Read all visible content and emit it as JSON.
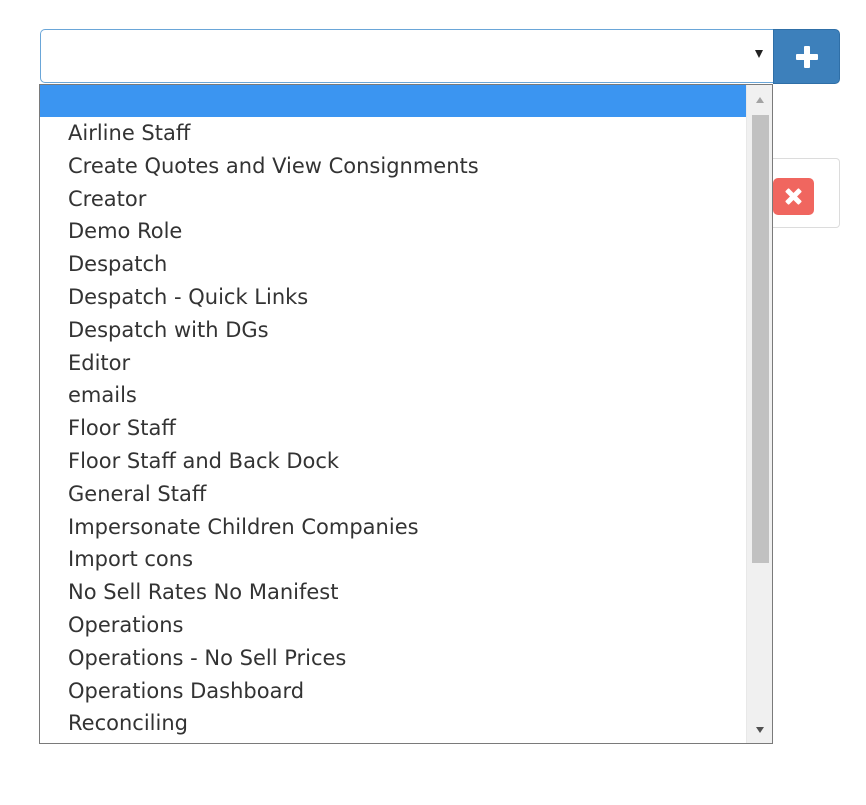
{
  "select": {
    "value": "",
    "caret_icon": "caret-down-icon"
  },
  "add_button": {
    "icon": "plus-icon",
    "color": "#3d80bb"
  },
  "remove_button": {
    "icon": "times-icon",
    "color": "#f0665f"
  },
  "dropdown": {
    "highlighted_option": "",
    "highlight_color": "#3b95f1",
    "options": [
      "Airline Staff",
      "Create Quotes and View Consignments",
      "Creator",
      "Demo Role",
      "Despatch",
      "Despatch - Quick Links",
      "Despatch with DGs",
      "Editor",
      "emails",
      "Floor Staff",
      "Floor Staff and Back Dock",
      "General Staff",
      "Impersonate Children Companies",
      "Import cons",
      "No Sell Rates No Manifest",
      "Operations",
      "Operations - No Sell Prices",
      "Operations Dashboard",
      "Reconciling"
    ]
  }
}
